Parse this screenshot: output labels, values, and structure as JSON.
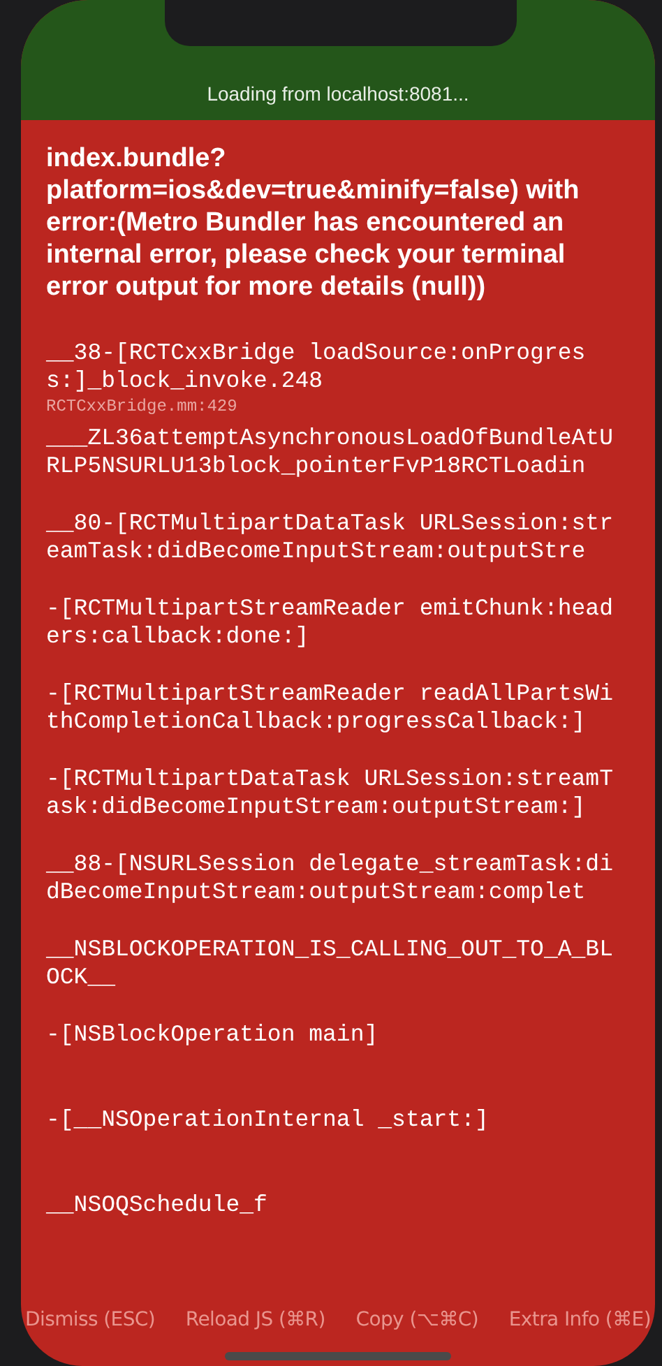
{
  "banner": {
    "text": "Loading from localhost:8081..."
  },
  "error_message": "index.bundle? platform=ios&dev=true&minify=false) with error:(Metro Bundler has encountered an internal error, please check your terminal error output for more details (null))",
  "stack_frames": [
    {
      "method": "__38-[RCTCxxBridge loadSource:onProgress:]_block_invoke.248",
      "file": "RCTCxxBridge.mm:429"
    },
    {
      "method": "___ZL36attemptAsynchronousLoadOfBundleAtURLP5NSURLU13block_pointerFvP18RCTLoadin"
    },
    {
      "method": "__80-[RCTMultipartDataTask URLSession:streamTask:didBecomeInputStream:outputStre"
    },
    {
      "method": "-[RCTMultipartStreamReader emitChunk:headers:callback:done:]"
    },
    {
      "method": "-[RCTMultipartStreamReader readAllPartsWithCompletionCallback:progressCallback:]"
    },
    {
      "method": "-[RCTMultipartDataTask URLSession:streamTask:didBecomeInputStream:outputStream:]"
    },
    {
      "method": "__88-[NSURLSession delegate_streamTask:didBecomeInputStream:outputStream:complet"
    },
    {
      "method": "__NSBLOCKOPERATION_IS_CALLING_OUT_TO_A_BLOCK__"
    },
    {
      "method": "-[NSBlockOperation main]"
    },
    {
      "method": "-[__NSOperationInternal _start:]"
    },
    {
      "method": "__NSOQSchedule_f"
    }
  ],
  "buttons": [
    "Dismiss (ESC)",
    "Reload JS (⌘R)",
    "Copy (⌥⌘C)",
    "Extra Info (⌘E)"
  ]
}
